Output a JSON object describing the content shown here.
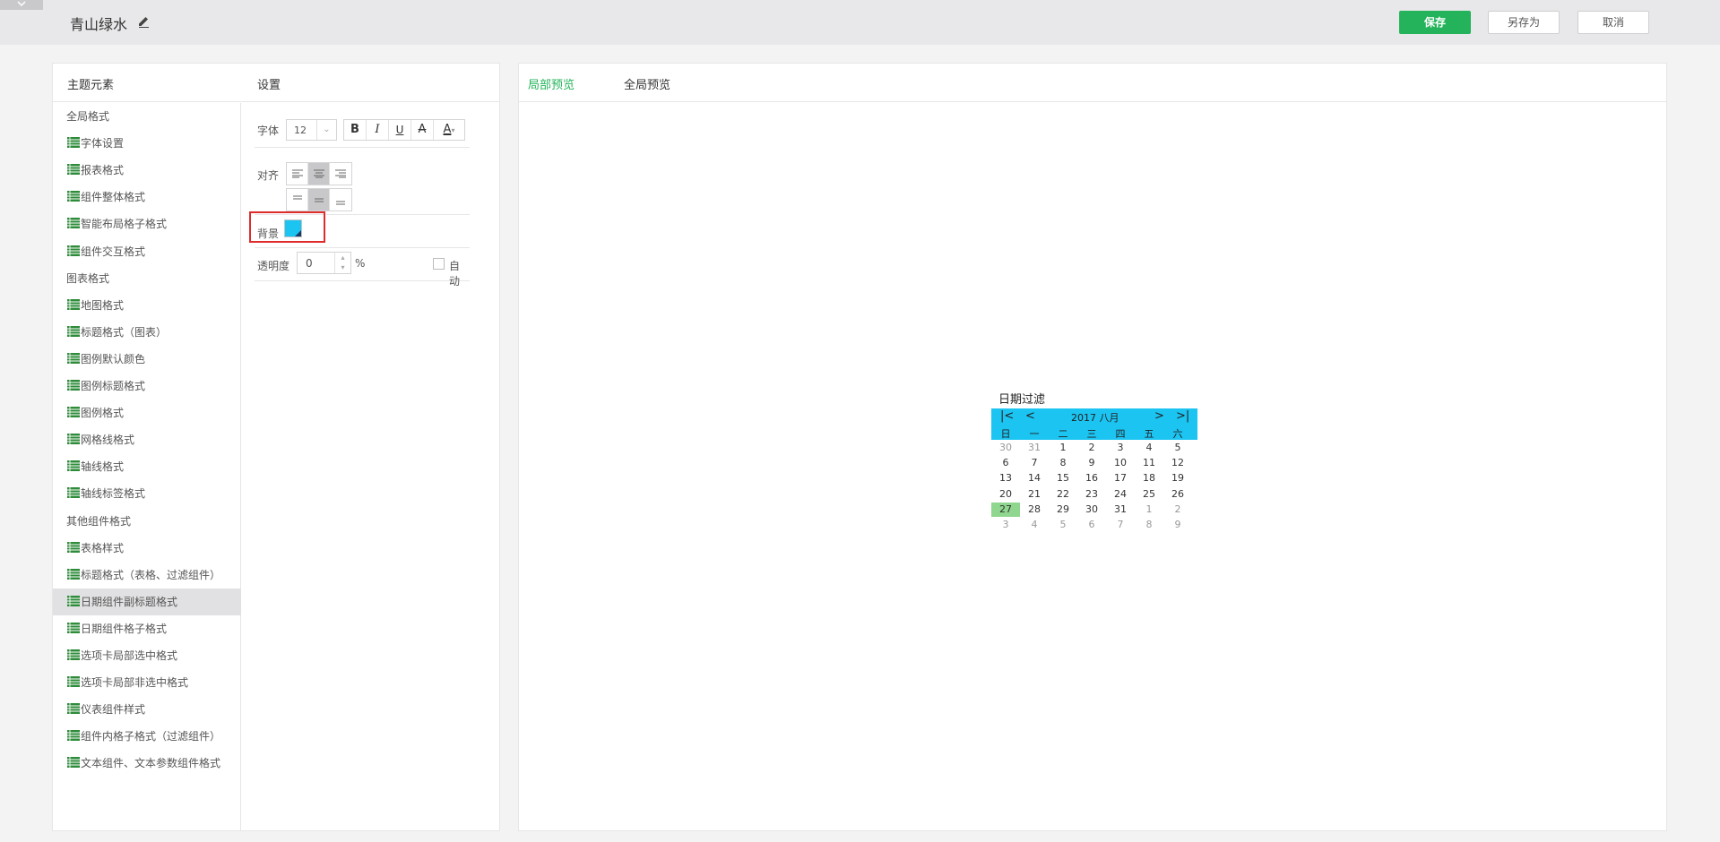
{
  "header": {
    "theme_name": "青山绿水",
    "save_label": "保存",
    "save_as_label": "另存为",
    "cancel_label": "取消"
  },
  "left_panel": {
    "elements_title": "主题元素",
    "settings_title": "设置",
    "tree": [
      {
        "label": "全局格式",
        "type": "group"
      },
      {
        "label": "字体设置",
        "type": "leaf"
      },
      {
        "label": "报表格式",
        "type": "leaf"
      },
      {
        "label": "组件整体格式",
        "type": "leaf"
      },
      {
        "label": "智能布局格子格式",
        "type": "leaf"
      },
      {
        "label": "组件交互格式",
        "type": "leaf"
      },
      {
        "label": "图表格式",
        "type": "group"
      },
      {
        "label": "地图格式",
        "type": "leaf"
      },
      {
        "label": "标题格式（图表）",
        "type": "leaf"
      },
      {
        "label": "图例默认颜色",
        "type": "leaf"
      },
      {
        "label": "图例标题格式",
        "type": "leaf"
      },
      {
        "label": "图例格式",
        "type": "leaf"
      },
      {
        "label": "网格线格式",
        "type": "leaf"
      },
      {
        "label": "轴线格式",
        "type": "leaf"
      },
      {
        "label": "轴线标签格式",
        "type": "leaf"
      },
      {
        "label": "其他组件格式",
        "type": "group"
      },
      {
        "label": "表格样式",
        "type": "leaf"
      },
      {
        "label": "标题格式（表格、过滤组件）",
        "type": "leaf"
      },
      {
        "label": "日期组件副标题格式",
        "type": "leaf",
        "selected": true
      },
      {
        "label": "日期组件格子格式",
        "type": "leaf"
      },
      {
        "label": "选项卡局部选中格式",
        "type": "leaf"
      },
      {
        "label": "选项卡局部非选中格式",
        "type": "leaf"
      },
      {
        "label": "仪表组件样式",
        "type": "leaf"
      },
      {
        "label": "组件内格子格式（过滤组件）",
        "type": "leaf"
      },
      {
        "label": "文本组件、文本参数组件格式",
        "type": "leaf"
      }
    ]
  },
  "settings": {
    "font_label": "字体",
    "font_size": "12",
    "bold": "B",
    "italic": "I",
    "underline": "U",
    "strike": "A",
    "font_color_glyph": "A",
    "align_label": "对齐",
    "background_label": "背景",
    "background_color": "#1cc4f2",
    "opacity_label": "透明度",
    "opacity_value": "0",
    "percent": "%",
    "auto_label": "自动"
  },
  "preview": {
    "tab_local": "局部预览",
    "tab_global": "全局预览",
    "calendar": {
      "title": "日期过滤",
      "nav_first": "|<",
      "nav_prev": "<",
      "year_month": "2017 八月",
      "nav_next": ">",
      "nav_last": ">|",
      "weekdays": [
        "日",
        "一",
        "二",
        "三",
        "四",
        "五",
        "六"
      ],
      "weeks": [
        [
          "30",
          "31",
          "1",
          "2",
          "3",
          "4",
          "5"
        ],
        [
          "6",
          "7",
          "8",
          "9",
          "10",
          "11",
          "12"
        ],
        [
          "13",
          "14",
          "15",
          "16",
          "17",
          "18",
          "19"
        ],
        [
          "20",
          "21",
          "22",
          "23",
          "24",
          "25",
          "26"
        ],
        [
          "27",
          "28",
          "29",
          "30",
          "31",
          "1",
          "2"
        ],
        [
          "3",
          "4",
          "5",
          "6",
          "7",
          "8",
          "9"
        ]
      ],
      "today": "27",
      "header_color": "#1cc4f2",
      "today_color": "#8fd68f"
    }
  },
  "colors": {
    "accent": "#24b35a",
    "highlight_border": "#e02b2b"
  }
}
